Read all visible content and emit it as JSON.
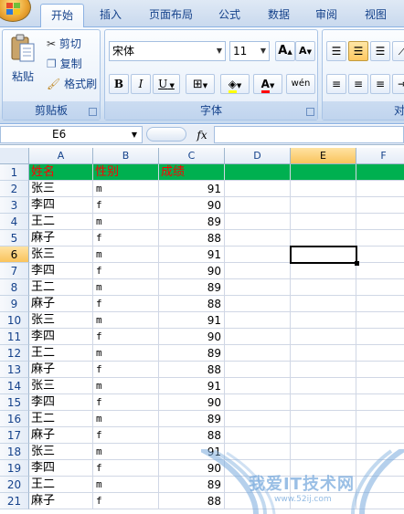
{
  "tabs": [
    "开始",
    "插入",
    "页面布局",
    "公式",
    "数据",
    "审阅",
    "视图"
  ],
  "active_tab": "开始",
  "clipboard": {
    "paste": "粘贴",
    "cut": "剪切",
    "copy": "复制",
    "format_painter": "格式刷",
    "label": "剪贴板"
  },
  "font": {
    "name": "宋体",
    "size": "11",
    "bold": "B",
    "italic": "I",
    "underline": "U",
    "grow": "A",
    "shrink": "A",
    "phonetic": "wén",
    "label": "字体"
  },
  "alignment": {
    "label": "对"
  },
  "formula_bar": {
    "name_box": "E6",
    "fx": "fx",
    "formula": ""
  },
  "columns": [
    "A",
    "B",
    "C",
    "D",
    "E",
    "F"
  ],
  "selected_cell": {
    "col": "E",
    "row": "6"
  },
  "header": {
    "name": "姓名",
    "gender": "性别",
    "score": "成绩"
  },
  "rows": [
    {
      "num": "1"
    },
    {
      "num": "2",
      "name": "张三",
      "gender": "m",
      "score": "91"
    },
    {
      "num": "3",
      "name": "李四",
      "gender": "f",
      "score": "90"
    },
    {
      "num": "4",
      "name": "王二",
      "gender": "m",
      "score": "89"
    },
    {
      "num": "5",
      "name": "麻子",
      "gender": "f",
      "score": "88"
    },
    {
      "num": "6",
      "name": "张三",
      "gender": "m",
      "score": "91"
    },
    {
      "num": "7",
      "name": "李四",
      "gender": "f",
      "score": "90"
    },
    {
      "num": "8",
      "name": "王二",
      "gender": "m",
      "score": "89"
    },
    {
      "num": "9",
      "name": "麻子",
      "gender": "f",
      "score": "88"
    },
    {
      "num": "10",
      "name": "张三",
      "gender": "m",
      "score": "91"
    },
    {
      "num": "11",
      "name": "李四",
      "gender": "f",
      "score": "90"
    },
    {
      "num": "12",
      "name": "王二",
      "gender": "m",
      "score": "89"
    },
    {
      "num": "13",
      "name": "麻子",
      "gender": "f",
      "score": "88"
    },
    {
      "num": "14",
      "name": "张三",
      "gender": "m",
      "score": "91"
    },
    {
      "num": "15",
      "name": "李四",
      "gender": "f",
      "score": "90"
    },
    {
      "num": "16",
      "name": "王二",
      "gender": "m",
      "score": "89"
    },
    {
      "num": "17",
      "name": "麻子",
      "gender": "f",
      "score": "88"
    },
    {
      "num": "18",
      "name": "张三",
      "gender": "m",
      "score": "91"
    },
    {
      "num": "19",
      "name": "李四",
      "gender": "f",
      "score": "90"
    },
    {
      "num": "20",
      "name": "王二",
      "gender": "m",
      "score": "89"
    },
    {
      "num": "21",
      "name": "麻子",
      "gender": "f",
      "score": "88"
    }
  ],
  "watermark": {
    "text": "我爱IT技术网",
    "url": "www.52ij.com"
  },
  "colors": {
    "header_fill": "#00b050",
    "header_text": "#ff0000",
    "ribbon_text": "#15428b"
  }
}
